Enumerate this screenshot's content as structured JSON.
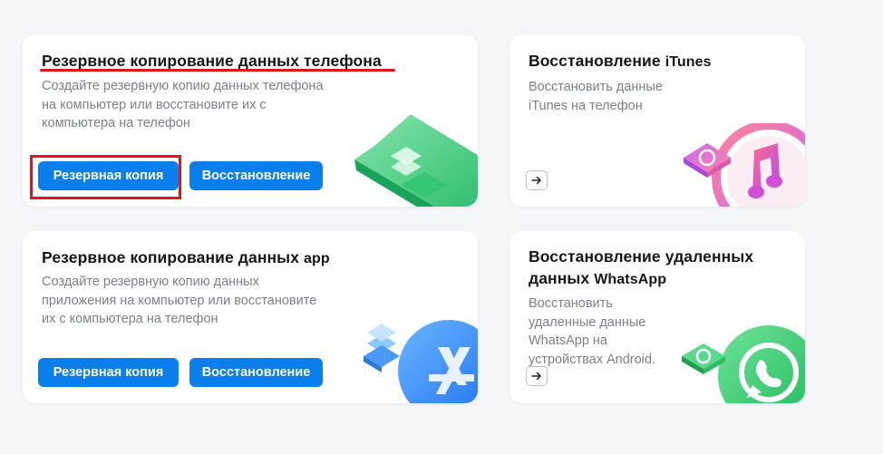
{
  "cards": [
    {
      "title": "Резервное копирование данных телефона",
      "description_lines": [
        "Создайте резервную копию данных телефона",
        "на компьютер или восстановите их с",
        "компьютера на телефон"
      ],
      "backup_label": "Резервная копия",
      "restore_label": "Восстановление"
    },
    {
      "title": "Восстановление",
      "title_latin": "iTunes",
      "description_lines": [
        "Восстановить данные",
        "iTunes на телефон"
      ]
    },
    {
      "title": "Резервное копирование данных",
      "title_latin": "app",
      "description_lines": [
        "Создайте резервную копию данных",
        "приложения на компьютер или восстановите",
        "их с компьютера на телефон"
      ],
      "backup_label": "Резервная копия",
      "restore_label": "Восстановление"
    },
    {
      "title_line1": "Восстановление удаленных",
      "title_line2": "данных",
      "title_latin": "WhatsApp",
      "description_lines": [
        "Восстановить",
        "удаленные данные",
        "WhatsApp на",
        "устройствах Android."
      ]
    }
  ],
  "colors": {
    "accent_blue": "#0a7eea",
    "highlight_red": "#e1131c",
    "background": "#f4f5f8"
  },
  "icons": [
    "phone-backup-icon",
    "itunes-icon",
    "app-store-icon",
    "whatsapp-icon",
    "arrow-right-icon"
  ]
}
